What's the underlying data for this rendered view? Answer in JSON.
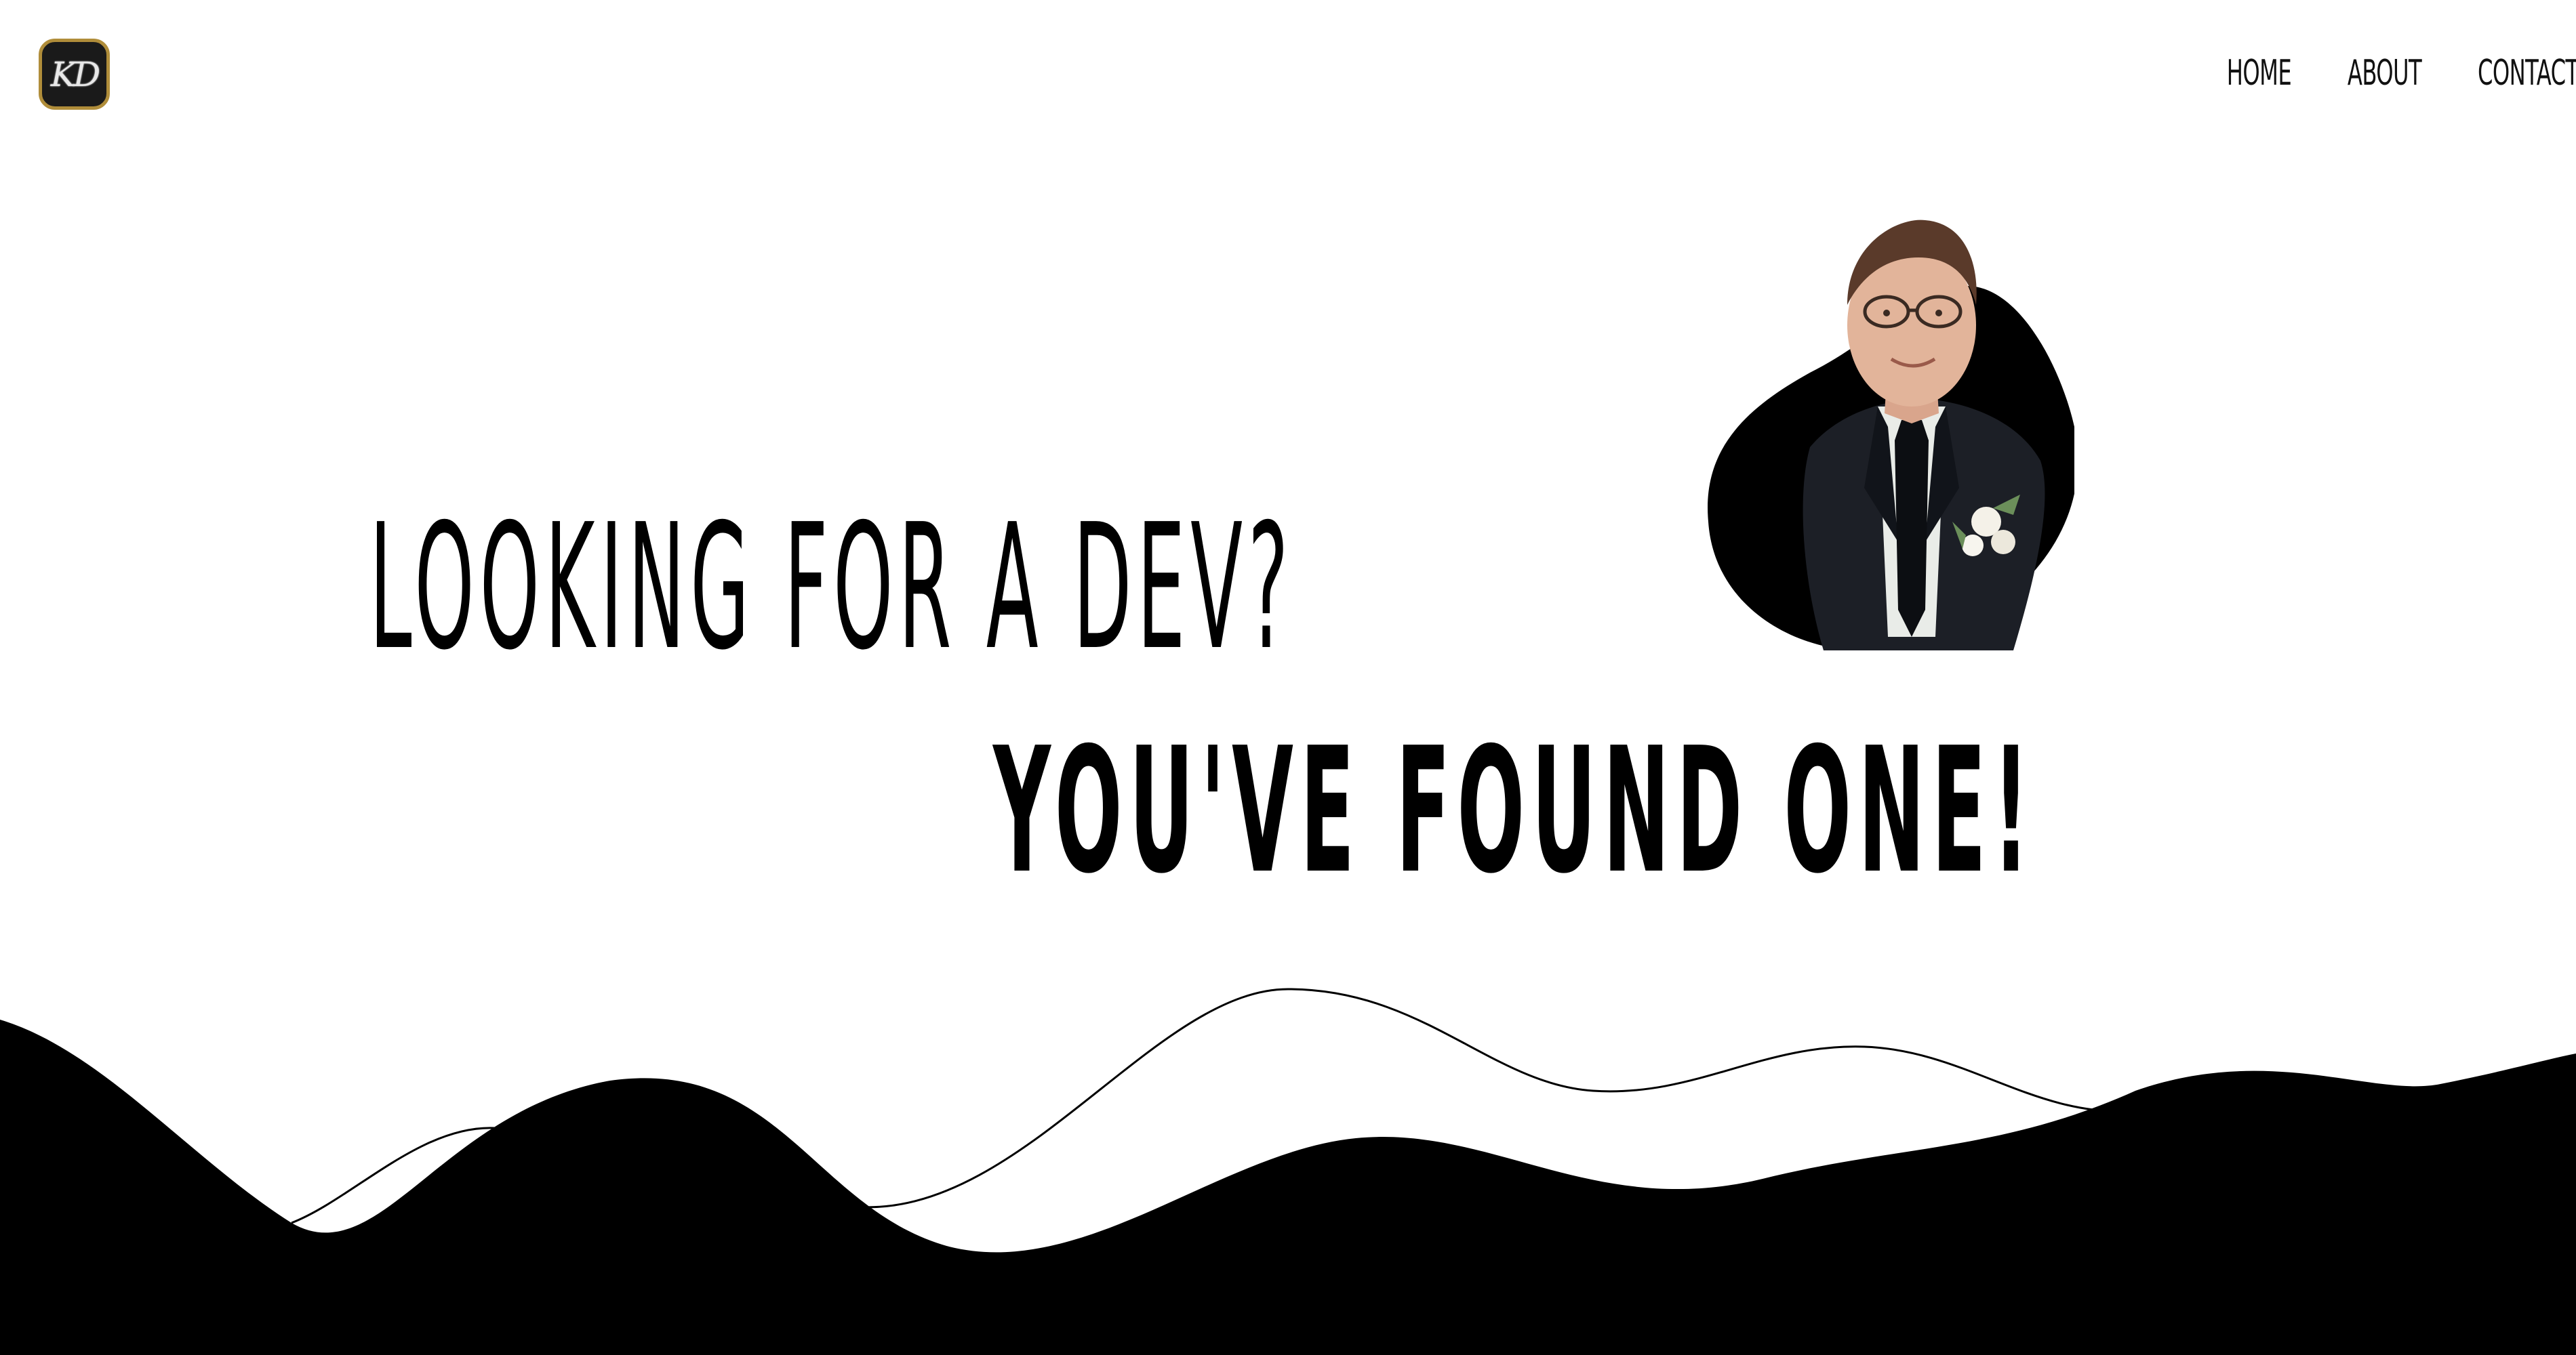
{
  "brand": {
    "logo_text": "KD",
    "accent_color": "#b08d3a"
  },
  "nav": {
    "items": [
      {
        "label": "HOME"
      },
      {
        "label": "ABOUT"
      },
      {
        "label": "CONTACT"
      }
    ]
  },
  "hero": {
    "line1": "Looking for a dev?",
    "line2": "You've found one!"
  },
  "colors": {
    "background": "#ffffff",
    "foreground": "#000000"
  }
}
